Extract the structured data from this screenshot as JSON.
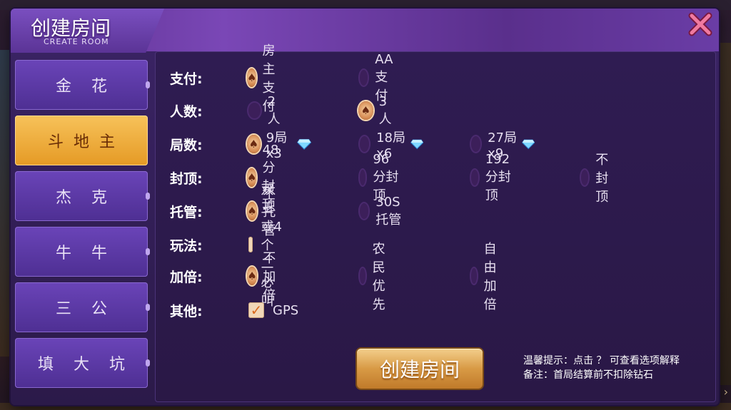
{
  "dialog": {
    "title": "创建房间",
    "subtitle": "CREATE ROOM"
  },
  "sidebar": {
    "items": [
      {
        "label": "金花",
        "active": false
      },
      {
        "label": "斗地主",
        "active": true
      },
      {
        "label": "杰克",
        "active": false
      },
      {
        "label": "牛牛",
        "active": false
      },
      {
        "label": "三公",
        "active": false
      },
      {
        "label": "填大坑",
        "active": false
      }
    ]
  },
  "options": {
    "payment": {
      "label": "支付",
      "choices": [
        "房主支付",
        "AA支付"
      ],
      "selected": "房主支付"
    },
    "players": {
      "label": "人数",
      "choices": [
        "2人",
        "3人"
      ],
      "selected": "3人"
    },
    "rounds": {
      "label": "局数",
      "choices": [
        "9局x3",
        "18局x6",
        "27局x9"
      ],
      "selected": "9局x3"
    },
    "cap": {
      "label": "封顶",
      "choices": [
        "48分封顶",
        "96分封顶",
        "192分封顶",
        "不封顶"
      ],
      "selected": "48分封顶"
    },
    "auto": {
      "label": "托管",
      "choices": [
        "不托管",
        "30S托管"
      ],
      "selected": "不托管"
    },
    "play": {
      "label": "玩法",
      "choices": [
        "双王或4个二必叫"
      ],
      "checked": false
    },
    "double": {
      "label": "加倍",
      "choices": [
        "不加倍",
        "农民优先",
        "自由加倍"
      ],
      "selected": "不加倍"
    },
    "other": {
      "label": "其他",
      "choices": [
        "GPS"
      ],
      "checked": true
    }
  },
  "actions": {
    "create_label": "创建房间"
  },
  "tips": {
    "line1": "温馨提示：点击 ？ 可查看选项解释",
    "line2": "备注：首局结算前不扣除钻石"
  },
  "colors": {
    "accent": "#e59a25",
    "panel": "#2b1a49",
    "diamond": "#5ec8ff"
  }
}
